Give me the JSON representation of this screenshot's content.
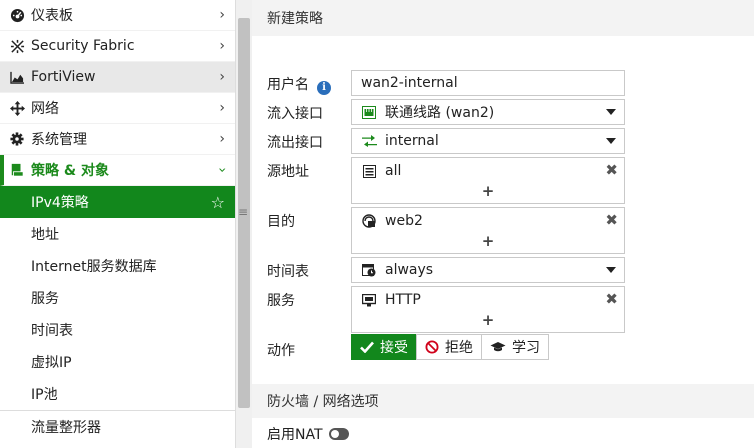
{
  "sidebar": {
    "items": [
      {
        "label": "仪表板",
        "icon": "dashboard-icon"
      },
      {
        "label": "Security Fabric",
        "icon": "fabric-icon"
      },
      {
        "label": "FortiView",
        "icon": "chart-icon"
      },
      {
        "label": "网络",
        "icon": "network-arrows-icon"
      },
      {
        "label": "系统管理",
        "icon": "gear-icon"
      },
      {
        "label": "策略 & 对象",
        "icon": "policy-icon"
      }
    ],
    "sub_items": [
      {
        "label": "IPv4策略"
      },
      {
        "label": "地址"
      },
      {
        "label": "Internet服务数据库"
      },
      {
        "label": "服务"
      },
      {
        "label": "时间表"
      },
      {
        "label": "虚拟IP"
      },
      {
        "label": "IP池"
      },
      {
        "label": "流量整形器"
      }
    ]
  },
  "form": {
    "title": "新建策略",
    "name_label": "用户名",
    "name_value": "wan2-internal",
    "incoming_label": "流入接口",
    "incoming_value": "联通线路 (wan2)",
    "outgoing_label": "流出接口",
    "outgoing_value": "internal",
    "source_label": "源地址",
    "source_value": "all",
    "destination_label": "目的",
    "destination_value": "web2",
    "schedule_label": "时间表",
    "schedule_value": "always",
    "service_label": "服务",
    "service_value": "HTTP",
    "action_label": "动作",
    "actions": [
      "接受",
      "拒绝",
      "学习"
    ],
    "add_symbol": "+",
    "remove_symbol": "✖",
    "firewall_section": "防火墙 / 网络选项",
    "nat_label": "启用NAT"
  },
  "colors": {
    "accent": "#12871c",
    "deny": "#d0021b",
    "info": "#2a6ebb"
  }
}
